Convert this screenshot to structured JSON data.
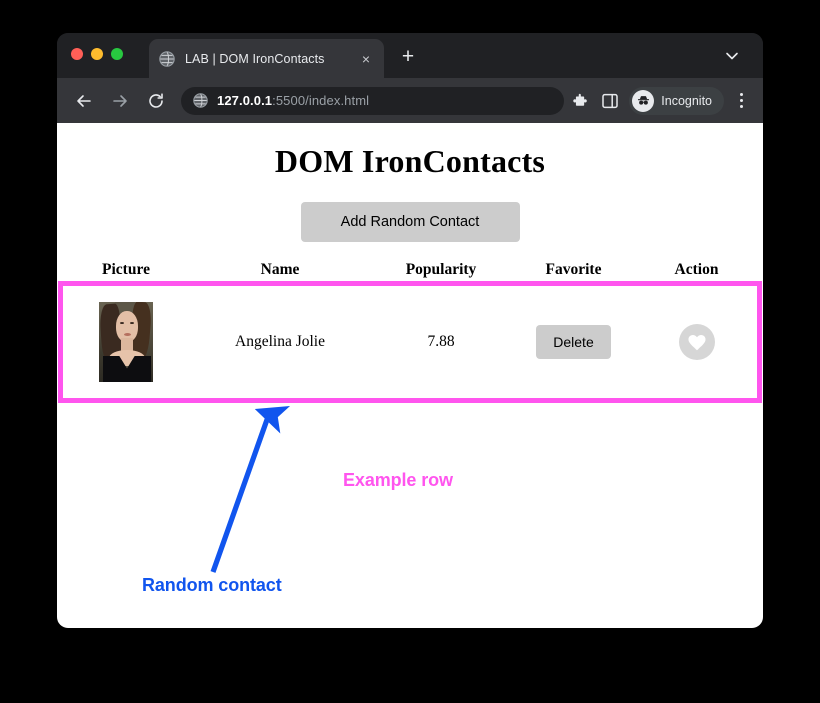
{
  "browser": {
    "window_controls": [
      {
        "name": "close",
        "color": "#ff5f57"
      },
      {
        "name": "minimize",
        "color": "#febc2e"
      },
      {
        "name": "maximize",
        "color": "#28c840"
      }
    ],
    "tab": {
      "title": "LAB | DOM IronContacts",
      "favicon": "globe-icon",
      "close_label": "×"
    },
    "new_tab_label": "+",
    "toolbar": {
      "back_label": "←",
      "forward_label": "→",
      "reload_label": "↻",
      "url_host": "127.0.0.1",
      "url_path": ":5500/index.html",
      "url_full": "127.0.0.1:5500/index.html",
      "extensions_label": "extensions-puzzle-icon",
      "sidepanel_label": "side-panel-icon",
      "incognito_label": "Incognito",
      "menu_label": "kebab-menu-icon"
    }
  },
  "page": {
    "title": "DOM IronContacts",
    "add_button_label": "Add Random Contact",
    "table": {
      "headers": [
        "Picture",
        "Name",
        "Popularity",
        "Favorite",
        "Action"
      ],
      "rows": [
        {
          "picture_alt": "Angelina Jolie portrait",
          "name": "Angelina Jolie",
          "popularity": "7.88",
          "favorite_button_label": "Delete",
          "action_icon": "heart-icon"
        }
      ]
    }
  },
  "annotations": [
    {
      "text": "Example row",
      "color": "#ff55ee"
    },
    {
      "text": "Random contact",
      "color": "#1155ee"
    }
  ],
  "colors": {
    "annotation_pink": "#ff55ee",
    "annotation_blue": "#1155ee",
    "button_gray": "#cccccc",
    "chrome_dark": "#202124",
    "chrome_toolbar": "#35363a"
  }
}
